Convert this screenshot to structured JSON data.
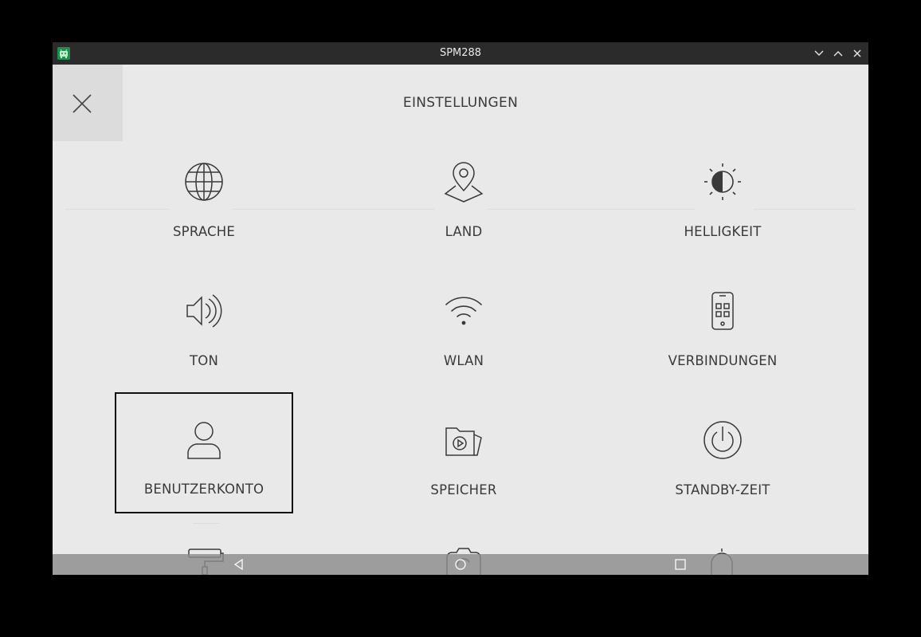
{
  "window": {
    "title": "SPM288"
  },
  "header": {
    "title": "EINSTELLUNGEN"
  },
  "tiles": [
    {
      "label": "SPRACHE",
      "icon": "globe-icon"
    },
    {
      "label": "LAND",
      "icon": "map-pin-icon"
    },
    {
      "label": "HELLIGKEIT",
      "icon": "brightness-icon"
    },
    {
      "label": "TON",
      "icon": "speaker-icon"
    },
    {
      "label": "WLAN",
      "icon": "wifi-icon"
    },
    {
      "label": "VERBINDUNGEN",
      "icon": "phone-app-icon"
    },
    {
      "label": "BENUTZERKONTO",
      "icon": "user-icon",
      "selected": true
    },
    {
      "label": "SPEICHER",
      "icon": "media-folder-icon"
    },
    {
      "label": "STANDBY-ZEIT",
      "icon": "power-icon"
    }
  ],
  "partial_tiles": [
    {
      "icon": "paint-roller-icon"
    },
    {
      "icon": "camera-switch-icon"
    },
    {
      "icon": "bell-icon"
    }
  ],
  "navbar": [
    "back-icon",
    "home-icon",
    "recents-icon"
  ],
  "colors": {
    "background": "#e9e9e9",
    "titlebar": "#2b2b2b",
    "icon_stroke": "#3a3a3a",
    "selection": "#111111"
  }
}
